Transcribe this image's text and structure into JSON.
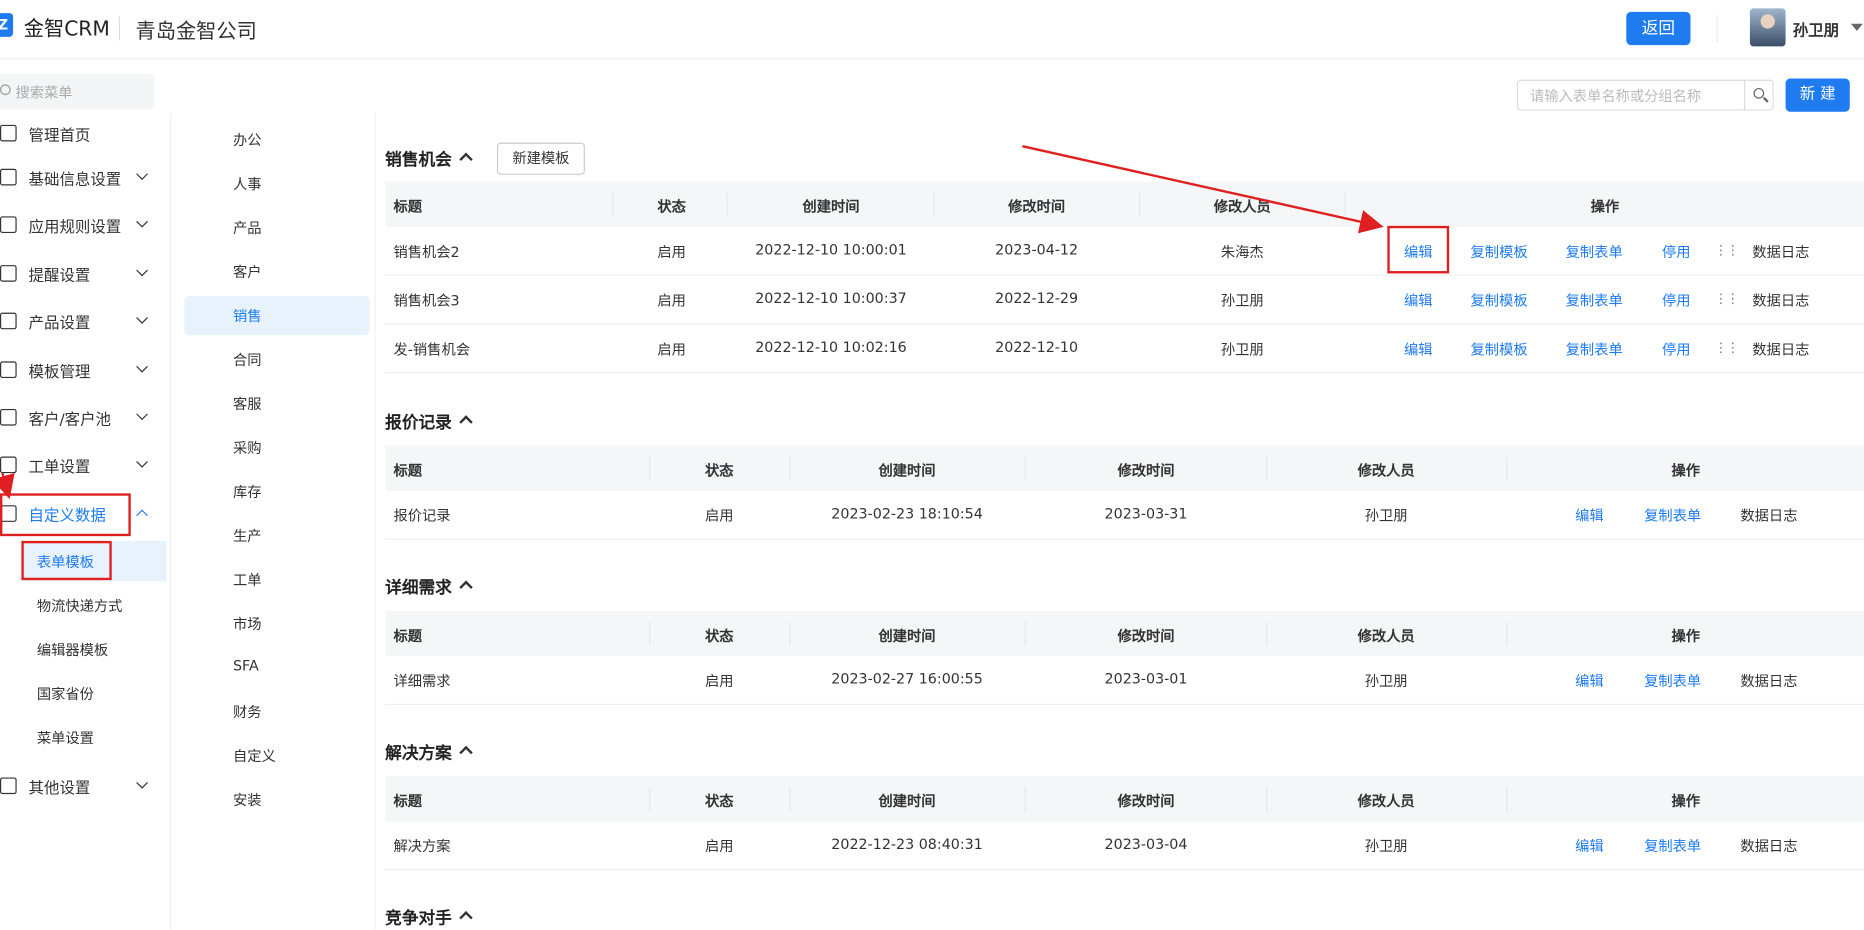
{
  "header": {
    "logo_mark": "Z",
    "logo_text": "金智CRM",
    "company": "青岛金智公司",
    "back_label": "返回",
    "user_name": "孙卫朋"
  },
  "menu": {
    "search_placeholder": "搜索菜单",
    "items": [
      {
        "label": "管理首页",
        "icon": "home-icon"
      },
      {
        "label": "基础信息设置",
        "icon": "cube-icon"
      },
      {
        "label": "应用规则设置",
        "icon": "document-icon"
      },
      {
        "label": "提醒设置",
        "icon": "bell-icon"
      },
      {
        "label": "产品设置",
        "icon": "box-icon"
      },
      {
        "label": "模板管理",
        "icon": "template-icon"
      },
      {
        "label": "客户/客户池",
        "icon": "customer-icon"
      },
      {
        "label": "工单设置",
        "icon": "ticket-icon"
      },
      {
        "label": "自定义数据",
        "icon": "tools-icon"
      },
      {
        "label": "其他设置",
        "icon": "grid-icon"
      }
    ],
    "sub_items": [
      "表单模板",
      "物流快递方式",
      "编辑器模板",
      "国家省份",
      "菜单设置"
    ]
  },
  "categories": [
    "办公",
    "人事",
    "产品",
    "客户",
    "销售",
    "合同",
    "客服",
    "采购",
    "库存",
    "生产",
    "工单",
    "市场",
    "SFA",
    "财务",
    "自定义",
    "安装"
  ],
  "toolbar": {
    "search_placeholder": "请输入表单名称或分组名称",
    "new_label": "新 建"
  },
  "columns": [
    "标题",
    "状态",
    "创建时间",
    "修改时间",
    "修改人员",
    "操作"
  ],
  "actions": {
    "edit": "编辑",
    "copy_template": "复制模板",
    "copy_form": "复制表单",
    "disable": "停用",
    "log": "数据日志"
  },
  "sections": [
    {
      "title": "销售机会",
      "template_button": "新建模板",
      "rows": [
        {
          "title": "销售机会2",
          "status": "启用",
          "created": "2022-12-10 10:00:01",
          "modified": "2023-04-12",
          "modifier": "朱海杰"
        },
        {
          "title": "销售机会3",
          "status": "启用",
          "created": "2022-12-10 10:00:37",
          "modified": "2022-12-29",
          "modifier": "孙卫朋"
        },
        {
          "title": "发-销售机会",
          "status": "启用",
          "created": "2022-12-10 10:02:16",
          "modified": "2022-12-10",
          "modifier": "孙卫朋"
        }
      ]
    },
    {
      "title": "报价记录",
      "rows": [
        {
          "title": "报价记录",
          "status": "启用",
          "created": "2023-02-23 18:10:54",
          "modified": "2023-03-31",
          "modifier": "孙卫朋"
        }
      ]
    },
    {
      "title": "详细需求",
      "rows": [
        {
          "title": "详细需求",
          "status": "启用",
          "created": "2023-02-27 16:00:55",
          "modified": "2023-03-01",
          "modifier": "孙卫朋"
        }
      ]
    },
    {
      "title": "解决方案",
      "rows": [
        {
          "title": "解决方案",
          "status": "启用",
          "created": "2022-12-23 08:40:31",
          "modified": "2023-03-04",
          "modifier": "孙卫朋"
        }
      ]
    },
    {
      "title": "竞争对手",
      "rows": []
    }
  ],
  "colors": {
    "accent": "#1e7bf0",
    "annotation": "#e02020"
  }
}
